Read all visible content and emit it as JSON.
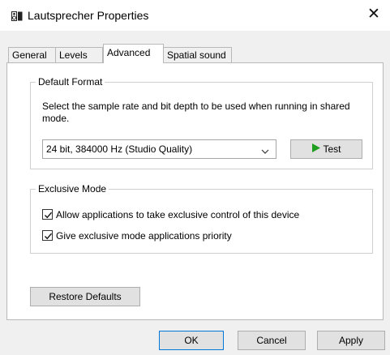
{
  "window": {
    "title": "Lautsprecher Properties",
    "app_icon": "speaker-icon",
    "close_glyph": "✕"
  },
  "tabs": [
    {
      "label": "General",
      "active": false
    },
    {
      "label": "Levels",
      "active": false
    },
    {
      "label": "Advanced",
      "active": true
    },
    {
      "label": "Spatial sound",
      "active": false
    }
  ],
  "default_format": {
    "legend": "Default Format",
    "description": "Select the sample rate and bit depth to be used when running in shared mode.",
    "selected": "24 bit, 384000 Hz (Studio Quality)",
    "test_label": "Test",
    "test_icon": "play-icon"
  },
  "exclusive_mode": {
    "legend": "Exclusive Mode",
    "options": [
      {
        "label": "Allow applications to take exclusive control of this device",
        "checked": true
      },
      {
        "label": "Give exclusive mode applications priority",
        "checked": true
      }
    ]
  },
  "restore_label": "Restore Defaults",
  "footer": {
    "ok": "OK",
    "cancel": "Cancel",
    "apply": "Apply"
  },
  "colors": {
    "accent": "#0078d7",
    "play": "#1f9e1f"
  }
}
